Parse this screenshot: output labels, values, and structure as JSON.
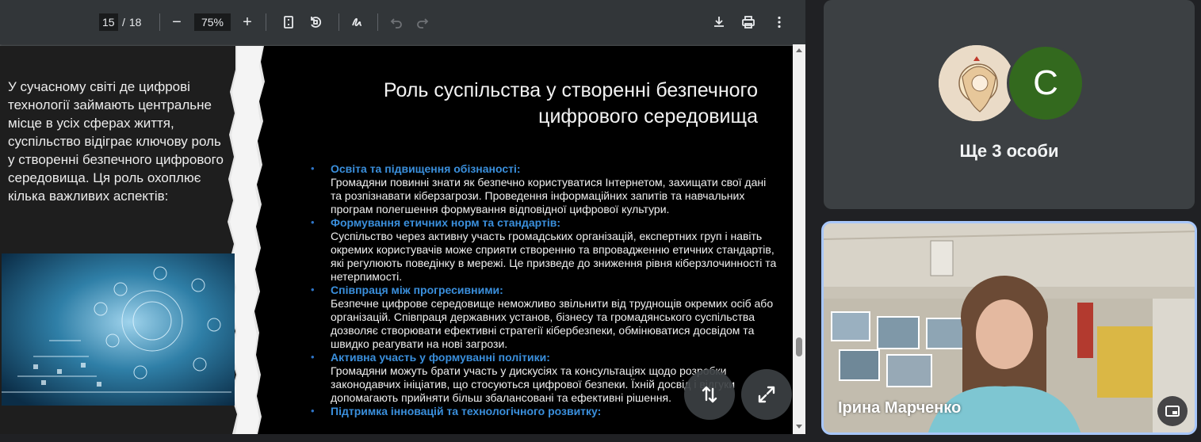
{
  "pdf_toolbar": {
    "current_page": "15",
    "page_separator": "/",
    "total_pages": "18",
    "zoom": "75%",
    "zoom_out_label": "−",
    "zoom_in_label": "+"
  },
  "slide": {
    "title_line1": "Роль суспільства у створенні безпечного",
    "title_line2": "цифрового середовища",
    "intro_text": "У сучасному світі де цифрові технології займають центральне місце в усіх сферах життя, суспільство відіграє ключову роль у створенні безпечного цифрового середовища. Ця роль охоплює кілька важливих аспектів:",
    "bullet_symbol": "•",
    "bullets": [
      {
        "heading": "Освіта та підвищення обізнаності:",
        "text": "Громадяни повинні знати як безпечно користуватися Інтернетом, захищати свої дані та розпізнавати кіберзагрози. Проведення інформаційних запитів та навчальних програм полегшення формування відповідної цифрової культури."
      },
      {
        "heading": "Формування етичних норм та стандартів:",
        "text": "Суспільство через активну участь громадських організацій, експертних груп і навіть окремих користувачів може сприяти створенню та впровадженню етичних стандартів, які регулюють поведінку в мережі. Це призведе до зниження рівня кіберзлочинності та нетерпимості."
      },
      {
        "heading": "Співпраця між прогресивними:",
        "text": "Безпечне цифрове середовище неможливо звільнити від труднощів окремих осіб або організацій. Співпраця державних установ, бізнесу та громадянського суспільства дозволяє створювати ефективні стратегії кібербезпеки, обмінюватися досвідом та швидко реагувати на нові загрози."
      },
      {
        "heading": "Активна участь у формуванні політики:",
        "text": "Громадяни можуть брати участь у дискусіях та консультаціях щодо розробки законодавчих ініціатив, що стосуються цифрової безпеки. Їхній досвід і відгуки допомагають прийняти більш збалансовані та ефективні рішення."
      },
      {
        "heading": "Підтримка інновацій та технологічного розвитку:",
        "text": ""
      }
    ]
  },
  "meet": {
    "avatar_letter": "C",
    "others_label": "Ще 3 особи",
    "speaker_name": "Ірина Марченко"
  },
  "colors": {
    "toolbar_bg": "#323639",
    "bullet_heading": "#3a8fdc",
    "active_speaker_border": "#a8c7fa",
    "avatar_green": "#33691e"
  },
  "icons": [
    "fit-page-icon",
    "rotate-icon",
    "annotate-icon",
    "undo-icon",
    "redo-icon",
    "download-icon",
    "print-icon",
    "more-vert-icon",
    "swap-vertical-icon",
    "expand-icon",
    "picture-in-picture-icon"
  ]
}
